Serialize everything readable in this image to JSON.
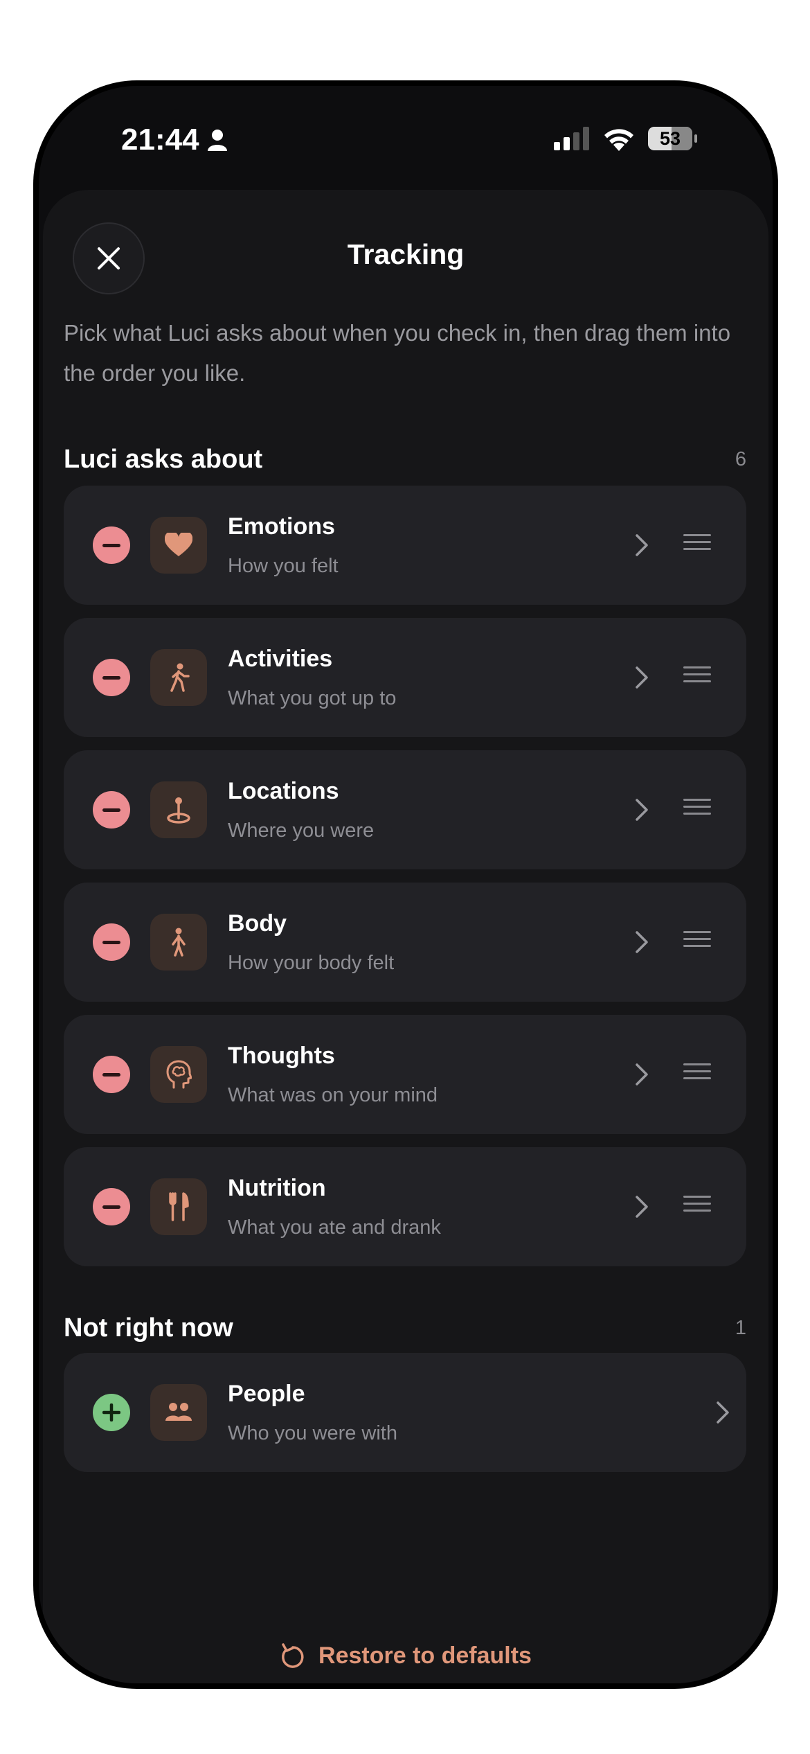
{
  "status_bar": {
    "time": "21:44",
    "battery": "53"
  },
  "header": {
    "title": "Tracking",
    "close_label": "Close"
  },
  "description": "Pick what Luci asks about when you check in, then drag them into the order you like.",
  "active_section": {
    "title": "Luci asks about",
    "count": "6",
    "items": [
      {
        "title": "Emotions",
        "subtitle": "How you felt",
        "icon": "heart-icon"
      },
      {
        "title": "Activities",
        "subtitle": "What you got up to",
        "icon": "walking-icon"
      },
      {
        "title": "Locations",
        "subtitle": "Where you were",
        "icon": "location-pin-icon"
      },
      {
        "title": "Body",
        "subtitle": "How your body felt",
        "icon": "body-figure-icon"
      },
      {
        "title": "Thoughts",
        "subtitle": "What was on your mind",
        "icon": "brain-head-icon"
      },
      {
        "title": "Nutrition",
        "subtitle": "What you ate and drank",
        "icon": "fork-knife-icon"
      }
    ]
  },
  "inactive_section": {
    "title": "Not right now",
    "count": "1",
    "items": [
      {
        "title": "People",
        "subtitle": "Who you were with",
        "icon": "people-icon"
      }
    ]
  },
  "footer": {
    "restore_label": "Restore to defaults"
  },
  "colors": {
    "accent": "#e0977a",
    "remove": "#ec8d92",
    "add": "#7cc783",
    "card": "#222226",
    "sheet": "#161618"
  }
}
